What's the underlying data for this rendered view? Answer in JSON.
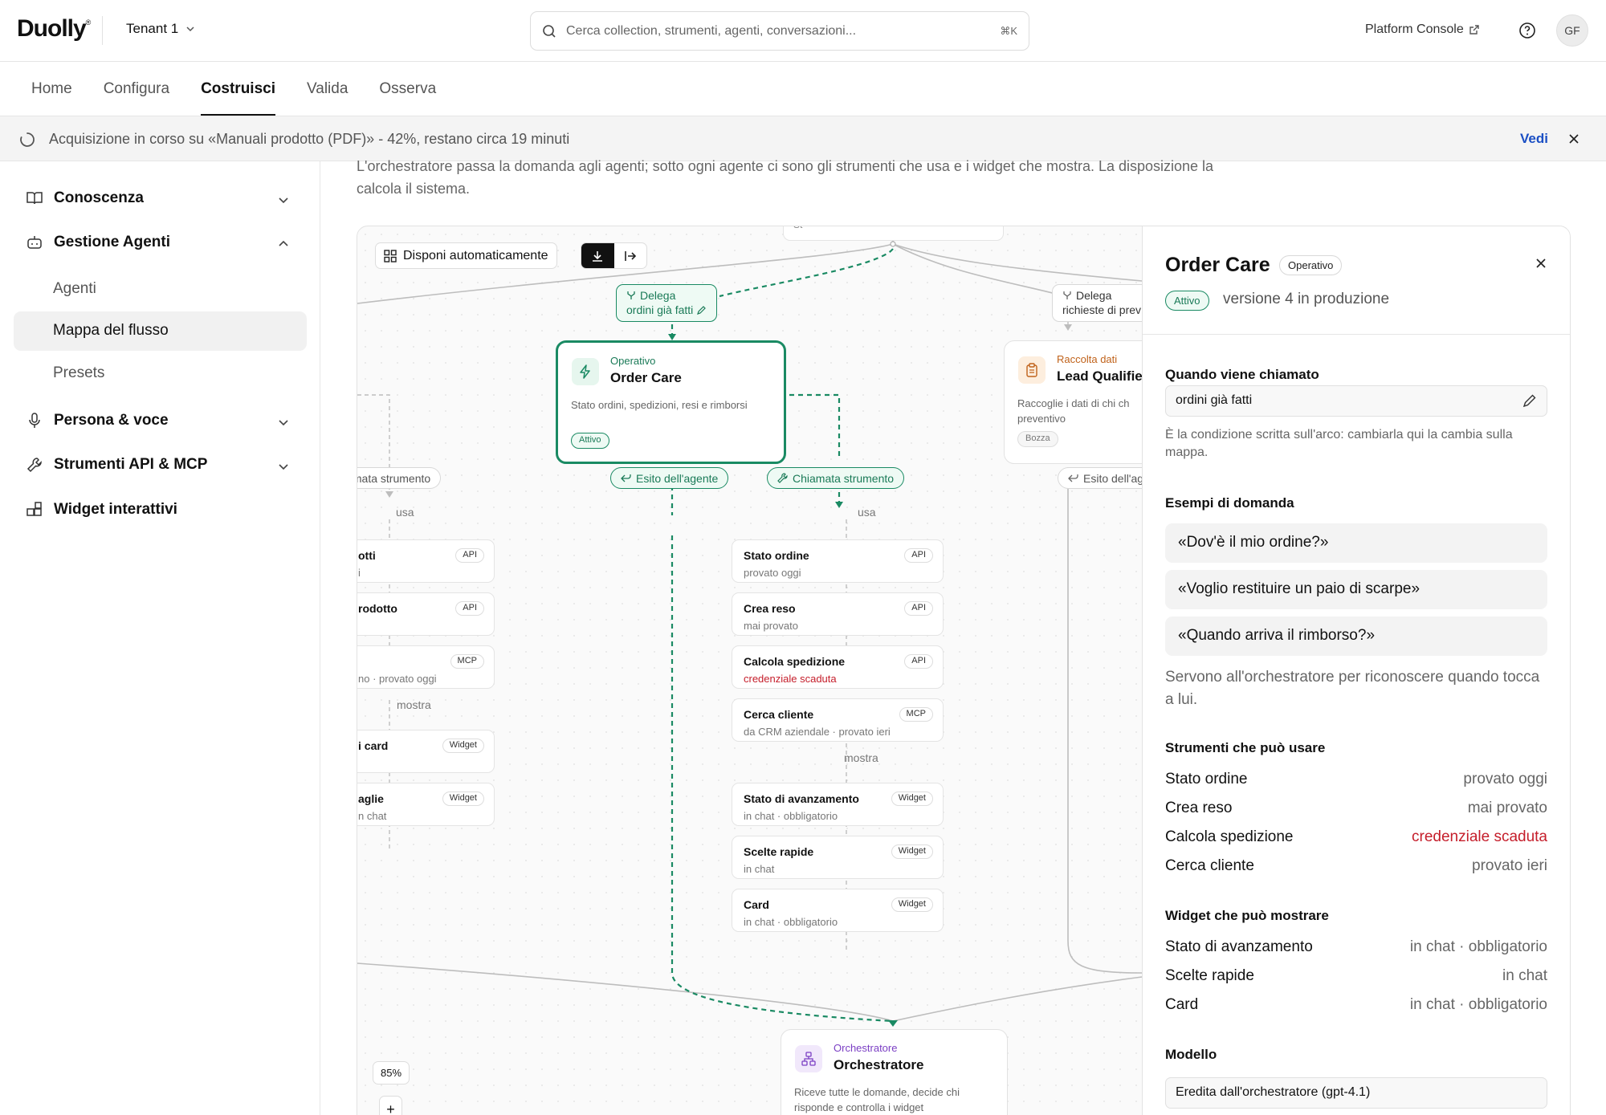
{
  "header": {
    "logo": "Duolly",
    "tenant": "Tenant 1",
    "search_placeholder": "Cerca collection, strumenti, agenti, conversazioni...",
    "search_shortcut": "⌘K",
    "platform_console": "Platform Console",
    "avatar_initials": "GF"
  },
  "nav": {
    "tabs": [
      {
        "label": "Home"
      },
      {
        "label": "Configura"
      },
      {
        "label": "Costruisci",
        "active": true
      },
      {
        "label": "Valida"
      },
      {
        "label": "Osserva"
      }
    ]
  },
  "banner": {
    "text": "Acquisizione in corso su «Manuali prodotto (PDF)» - 42%, restano circa 19 minuti",
    "action": "Vedi",
    "progress_percent": 42
  },
  "sidebar": {
    "sections": [
      {
        "label": "Conoscenza"
      },
      {
        "label": "Gestione Agenti",
        "expanded": true,
        "items": [
          {
            "label": "Agenti"
          },
          {
            "label": "Mappa del flusso",
            "active": true
          },
          {
            "label": "Presets"
          }
        ]
      },
      {
        "label": "Persona & voce"
      },
      {
        "label": "Strumenti API & MCP"
      },
      {
        "label": "Widget interattivi"
      }
    ]
  },
  "main": {
    "intro": "L'orchestratore passa la domanda agli agenti; sotto ogni agente ci sono gli strumenti che usa e i widget che mostra. La disposizione la calcola il sistema."
  },
  "canvas": {
    "toolbar": {
      "auto_layout": "Disponi automaticamente"
    },
    "zoom": "85%",
    "zoom_in": "+",
    "zoom_out": "−",
    "top_node_fragment": "St",
    "edges": {
      "delegate_order_care": {
        "prefix": "Delega",
        "condition": "ordini già fatti"
      },
      "delegate_lead": {
        "prefix": "Delega",
        "condition": "richieste di prev"
      },
      "uses": "usa",
      "shows": "mostra",
      "left_tool_call": "iamata strumento",
      "agent_result": "Esito dell'agente",
      "tool_call": "Chiamata strumento",
      "right_agent_result": "Esito dell'ag"
    },
    "agent": {
      "kind": "Operativo",
      "name": "Order Care",
      "description": "Stato ordini, spedizioni, resi e rimborsi",
      "status": "Attivo"
    },
    "lead_agent": {
      "kind": "Raccolta dati",
      "name": "Lead Qualifier",
      "description_line1": "Raccoglie i dati di chi ch",
      "description_line2": "preventivo",
      "status": "Bozza"
    },
    "orchestrator": {
      "kind": "Orchestratore",
      "name": "Orchestratore",
      "description_line1": "Riceve tutte le domande, decide chi",
      "description_line2": "risponde e controlla i widget"
    },
    "tools": [
      {
        "name": "Stato ordine",
        "sub": "provato oggi",
        "badge": "API"
      },
      {
        "name": "Crea reso",
        "sub": "mai provato",
        "badge": "API"
      },
      {
        "name": "Calcola spedizione",
        "sub": "credenziale scaduta",
        "badge": "API",
        "error": true
      },
      {
        "name": "Cerca cliente",
        "sub": "da CRM aziendale · provato ieri",
        "badge": "MCP"
      }
    ],
    "widgets": [
      {
        "name": "Stato di avanzamento",
        "sub": "in chat · obbligatorio",
        "badge": "Widget"
      },
      {
        "name": "Scelte rapide",
        "sub": "in chat",
        "badge": "Widget"
      },
      {
        "name": "Card",
        "sub": "in chat · obbligatorio",
        "badge": "Widget"
      }
    ],
    "left_tools": [
      {
        "name": "otti",
        "sub": "i",
        "badge": "API"
      },
      {
        "name": "rodotto",
        "sub": "",
        "badge": "API"
      },
      {
        "name": "",
        "sub": "no · provato oggi",
        "badge": "MCP"
      }
    ],
    "left_widgets": [
      {
        "name": "i card",
        "sub": "",
        "badge": "Widget"
      },
      {
        "name": "aglie",
        "sub": "n chat",
        "badge": "Widget"
      }
    ]
  },
  "panel": {
    "title": "Order Care",
    "kind_badge": "Operativo",
    "status": "Attivo",
    "version": "versione 4 in produzione",
    "when_called_label": "Quando viene chiamato",
    "when_called_value": "ordini già fatti",
    "when_called_help": "È la condizione scritta sull'arco: cambiarla qui la cambia sulla mappa.",
    "examples_label": "Esempi di domanda",
    "examples": [
      "«Dov'è il mio ordine?»",
      "«Voglio restituire un paio di scarpe»",
      "«Quando arriva il rimborso?»"
    ],
    "examples_help": "Servono all'orchestratore per riconoscere quando tocca a lui.",
    "tools_label": "Strumenti che può usare",
    "tools": [
      {
        "name": "Stato ordine",
        "value": "provato oggi"
      },
      {
        "name": "Crea reso",
        "value": "mai provato"
      },
      {
        "name": "Calcola spedizione",
        "value": "credenziale scaduta",
        "error": true
      },
      {
        "name": "Cerca cliente",
        "value": "provato ieri"
      }
    ],
    "widgets_label": "Widget che può mostrare",
    "widgets": [
      {
        "name": "Stato di avanzamento",
        "value": "in chat · obbligatorio"
      },
      {
        "name": "Scelte rapide",
        "value": "in chat"
      },
      {
        "name": "Card",
        "value": "in chat · obbligatorio"
      }
    ],
    "model_label": "Modello",
    "model_value": "Eredita dall'orchestratore (gpt-4.1)"
  },
  "colors": {
    "accent_green": "#1a8a63",
    "error_red": "#c51d2a",
    "link_blue": "#1b4fc4",
    "orchestrator_purple": "#7b3fc4",
    "lead_orange": "#c0621a"
  }
}
